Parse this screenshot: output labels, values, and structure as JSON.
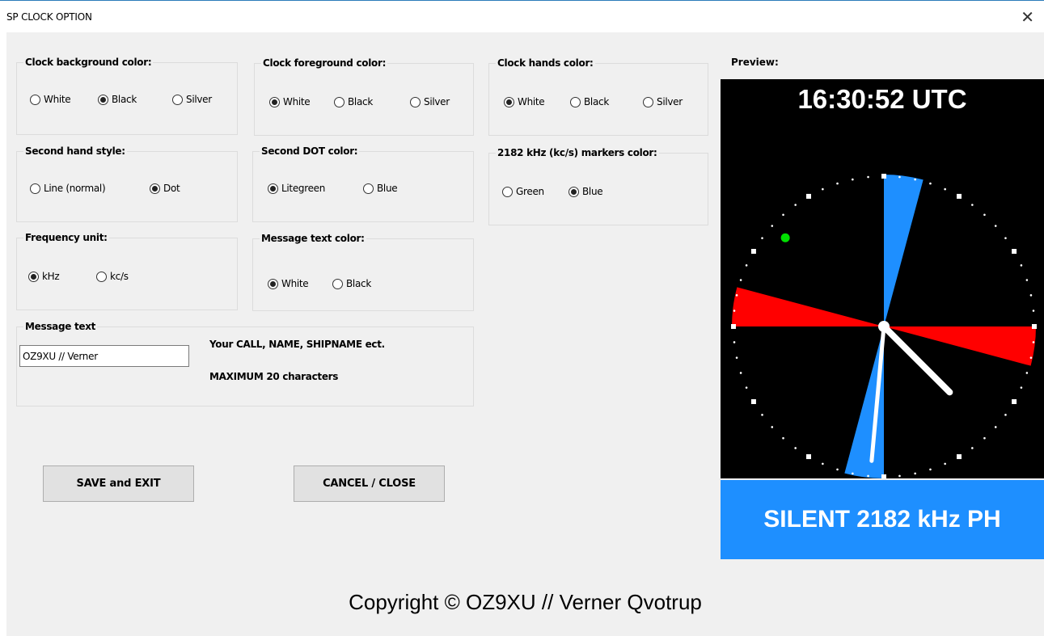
{
  "window": {
    "title": "SP CLOCK OPTION",
    "close_glyph": "✕"
  },
  "groups": {
    "bg_color": {
      "label": "Clock background color:",
      "options": [
        "White",
        "Black",
        "Silver"
      ],
      "selected": 1
    },
    "fg_color": {
      "label": "Clock foreground color:",
      "options": [
        "White",
        "Black",
        "Silver"
      ],
      "selected": 0
    },
    "hands_color": {
      "label": "Clock hands color:",
      "options": [
        "White",
        "Black",
        "Silver"
      ],
      "selected": 0
    },
    "second_style": {
      "label": "Second hand style:",
      "options": [
        "Line (normal)",
        "Dot"
      ],
      "selected": 1
    },
    "dot_color": {
      "label": "Second DOT color:",
      "options": [
        "Litegreen",
        "Blue"
      ],
      "selected": 0
    },
    "markers_color": {
      "label": "2182 kHz (kc/s) markers color:",
      "options": [
        "Green",
        "Blue"
      ],
      "selected": 1
    },
    "freq_unit": {
      "label": "Frequency unit:",
      "options": [
        "kHz",
        "kc/s"
      ],
      "selected": 0
    },
    "msg_color": {
      "label": "Message text color:",
      "options": [
        "White",
        "Black"
      ],
      "selected": 0
    }
  },
  "message": {
    "label": "Message text",
    "value": "OZ9XU // Verner",
    "hint1": "Your CALL, NAME, SHIPNAME ect.",
    "hint2": "MAXIMUM 20 characters"
  },
  "buttons": {
    "save": "SAVE and EXIT",
    "cancel": "CANCEL / CLOSE"
  },
  "preview": {
    "label": "Preview:",
    "time": "16:30:52 UTC",
    "banner": "SILENT 2182 kHz PH",
    "colors": {
      "background": "#000000",
      "silent_red": "#ff0000",
      "silent_blue": "#1e8fff",
      "hands": "#ffffff",
      "second_dot": "#00e000"
    }
  },
  "copyright": "Copyright © OZ9XU // Verner Qvotrup"
}
